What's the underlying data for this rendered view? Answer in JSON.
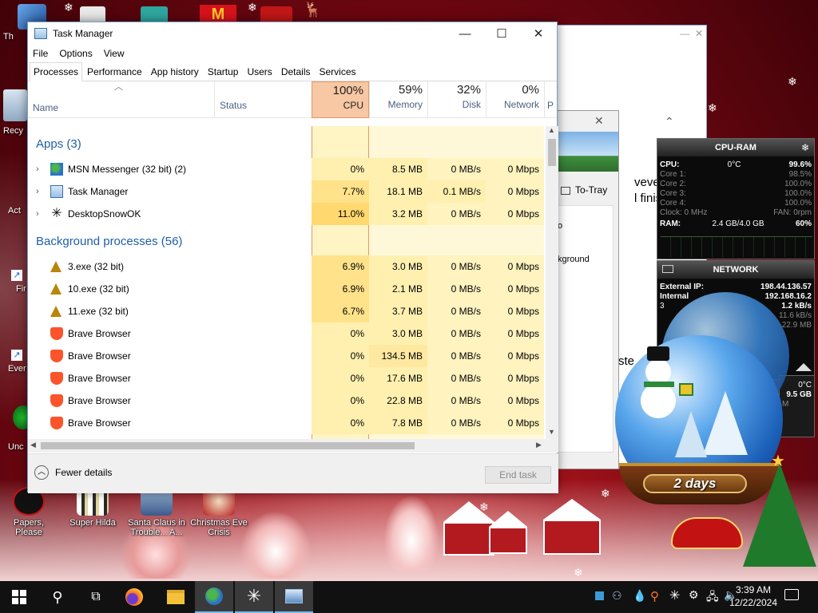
{
  "desktop": {
    "icons_left_partial": [
      "Th",
      "Recy",
      "Act",
      "Fir",
      "Ever",
      "Unc"
    ],
    "icons_bottom": [
      {
        "label": "Papers, Please"
      },
      {
        "label": "Super Hilda"
      },
      {
        "label": "Santa Claus in Trouble... A..."
      },
      {
        "label": "Christmas Eve Crisis"
      }
    ]
  },
  "task_manager": {
    "title": "Task Manager",
    "menu": [
      "File",
      "Options",
      "View"
    ],
    "tabs": [
      "Processes",
      "Performance",
      "App history",
      "Startup",
      "Users",
      "Details",
      "Services"
    ],
    "active_tab": "Processes",
    "columns": {
      "name": "Name",
      "status": "Status",
      "cpu": {
        "pct": "100%",
        "label": "CPU"
      },
      "memory": {
        "pct": "59%",
        "label": "Memory"
      },
      "disk": {
        "pct": "32%",
        "label": "Disk"
      },
      "network": {
        "pct": "0%",
        "label": "Network"
      },
      "power_partial": "P"
    },
    "groups": {
      "apps": "Apps (3)",
      "background": "Background processes (56)"
    },
    "apps": [
      {
        "name": "MSN Messenger (32 bit) (2)",
        "cpu": "0%",
        "memory": "8.5 MB",
        "disk": "0 MB/s",
        "network": "0 Mbps",
        "icon": "msn-icon"
      },
      {
        "name": "Task Manager",
        "cpu": "7.7%",
        "memory": "18.1 MB",
        "disk": "0.1 MB/s",
        "network": "0 Mbps",
        "icon": "task-manager-icon"
      },
      {
        "name": "DesktopSnowOK",
        "cpu": "11.0%",
        "memory": "3.2 MB",
        "disk": "0 MB/s",
        "network": "0 Mbps",
        "icon": "snowflake-icon"
      }
    ],
    "background": [
      {
        "name": "3.exe (32 bit)",
        "cpu": "6.9%",
        "memory": "3.0 MB",
        "disk": "0 MB/s",
        "network": "0 Mbps",
        "icon": "tree-icon"
      },
      {
        "name": "10.exe (32 bit)",
        "cpu": "6.9%",
        "memory": "2.1 MB",
        "disk": "0 MB/s",
        "network": "0 Mbps",
        "icon": "tree-icon"
      },
      {
        "name": "11.exe (32 bit)",
        "cpu": "6.7%",
        "memory": "3.7 MB",
        "disk": "0 MB/s",
        "network": "0 Mbps",
        "icon": "tree-icon"
      },
      {
        "name": "Brave Browser",
        "cpu": "0%",
        "memory": "3.0 MB",
        "disk": "0 MB/s",
        "network": "0 Mbps",
        "icon": "brave-icon"
      },
      {
        "name": "Brave Browser",
        "cpu": "0%",
        "memory": "134.5 MB",
        "disk": "0 MB/s",
        "network": "0 Mbps",
        "icon": "brave-icon"
      },
      {
        "name": "Brave Browser",
        "cpu": "0%",
        "memory": "17.6 MB",
        "disk": "0 MB/s",
        "network": "0 Mbps",
        "icon": "brave-icon"
      },
      {
        "name": "Brave Browser",
        "cpu": "0%",
        "memory": "22.8 MB",
        "disk": "0 MB/s",
        "network": "0 Mbps",
        "icon": "brave-icon"
      },
      {
        "name": "Brave Browser",
        "cpu": "0%",
        "memory": "7.8 MB",
        "disk": "0 MB/s",
        "network": "0 Mbps",
        "icon": "brave-icon"
      }
    ],
    "fewer_details": "Fewer details",
    "end_task": "End task"
  },
  "background_window": {
    "text_lines": [
      "vever.",
      "l finish"
    ],
    "to_tray": "To-Tray",
    "partial_o": "o",
    "background_partial": "kground",
    "partial_ste": "ste"
  },
  "cpu_ram_gadget": {
    "title": "CPU-RAM",
    "cpu_label": "CPU:",
    "temp": "0°C",
    "cpu_total": "99.6%",
    "cores": [
      {
        "label": "Core 1:",
        "value": "98.5%"
      },
      {
        "label": "Core 2:",
        "value": "100.0%"
      },
      {
        "label": "Core 3:",
        "value": "100.0%"
      },
      {
        "label": "Core 4:",
        "value": "100.0%"
      }
    ],
    "clock": "Clock: 0 MHz",
    "fan": "FAN: 0rpm",
    "ram_label": "RAM:",
    "ram_value": "2.4 GB/4.0 GB",
    "ram_pct": "60%"
  },
  "network_gadget": {
    "title": "NETWORK",
    "external_label": "External IP:",
    "external_ip": "198.44.136.57",
    "internal_label": "Internal",
    "internal_ip": "192.168.16.2",
    "line3_prefix": "3",
    "up": "1.2 kB/s",
    "down": "11.6 kB/s",
    "total": "22.9 MB"
  },
  "partial_gadget": {
    "temp": "0°C",
    "size": "9.5 GB",
    "m": "M"
  },
  "snowglobe": {
    "label": "2 days"
  },
  "taskbar": {
    "time": "3:39 AM",
    "date": "12/22/2024"
  }
}
